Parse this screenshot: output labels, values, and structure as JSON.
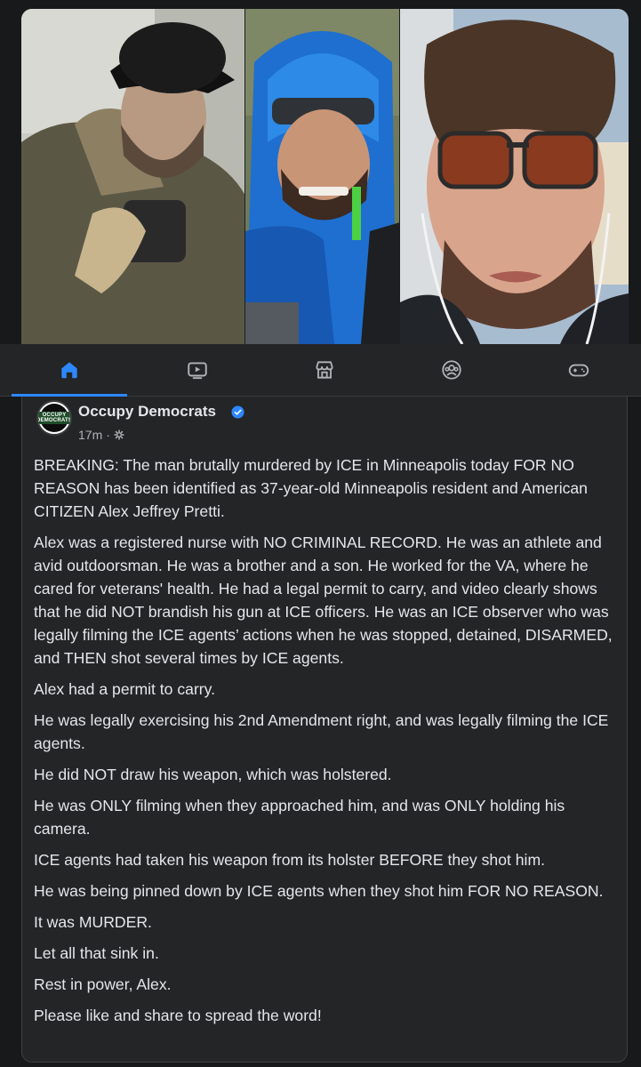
{
  "photos": [
    {
      "alt": "man in black cap and olive jacket holding phone"
    },
    {
      "alt": "smiling man in blue hooded jacket outdoors"
    },
    {
      "alt": "man with sunglasses pushed up on forehead"
    }
  ],
  "navbar": {
    "items": [
      {
        "name": "home",
        "icon": "home-icon",
        "active": true
      },
      {
        "name": "video",
        "icon": "video-icon",
        "active": false
      },
      {
        "name": "marketplace",
        "icon": "marketplace-icon",
        "active": false
      },
      {
        "name": "groups",
        "icon": "groups-icon",
        "active": false
      },
      {
        "name": "gaming",
        "icon": "gaming-icon",
        "active": false
      }
    ],
    "active_color": "#2d88ff"
  },
  "post": {
    "author": "Occupy Democrats",
    "avatar_text": "OCCUPY DEMOCRATS",
    "verified": true,
    "time": "17m",
    "separator": "·",
    "paragraphs": [
      "BREAKING: The man brutally murdered by ICE in Minneapolis today FOR NO REASON has been identified as 37-year-old Minneapolis resident and American CITIZEN Alex Jeffrey Pretti.",
      "Alex was a registered nurse with NO CRIMINAL RECORD. He was an athlete and avid outdoorsman. He was a brother and a son. He worked for the VA, where he cared for veterans' health. He had a legal permit to carry, and video clearly shows that he did NOT brandish his gun at ICE officers. He was an ICE observer who was legally filming the ICE agents’ actions when he was stopped, detained, DISARMED, and THEN shot several times by ICE agents.",
      "Alex had a permit to carry.",
      "He was legally exercising his 2nd Amendment right, and was legally filming the ICE agents.",
      "He did NOT draw his weapon, which was holstered.",
      "He was ONLY filming when they approached him, and was ONLY holding his camera.",
      "ICE agents had taken his weapon from its holster BEFORE they shot him.",
      "He was being pinned down by ICE agents when they shot him FOR NO REASON.",
      "It was MURDER.",
      "Let all that sink in.",
      "Rest in power, Alex.",
      "Please like and share to spread the word!"
    ]
  }
}
